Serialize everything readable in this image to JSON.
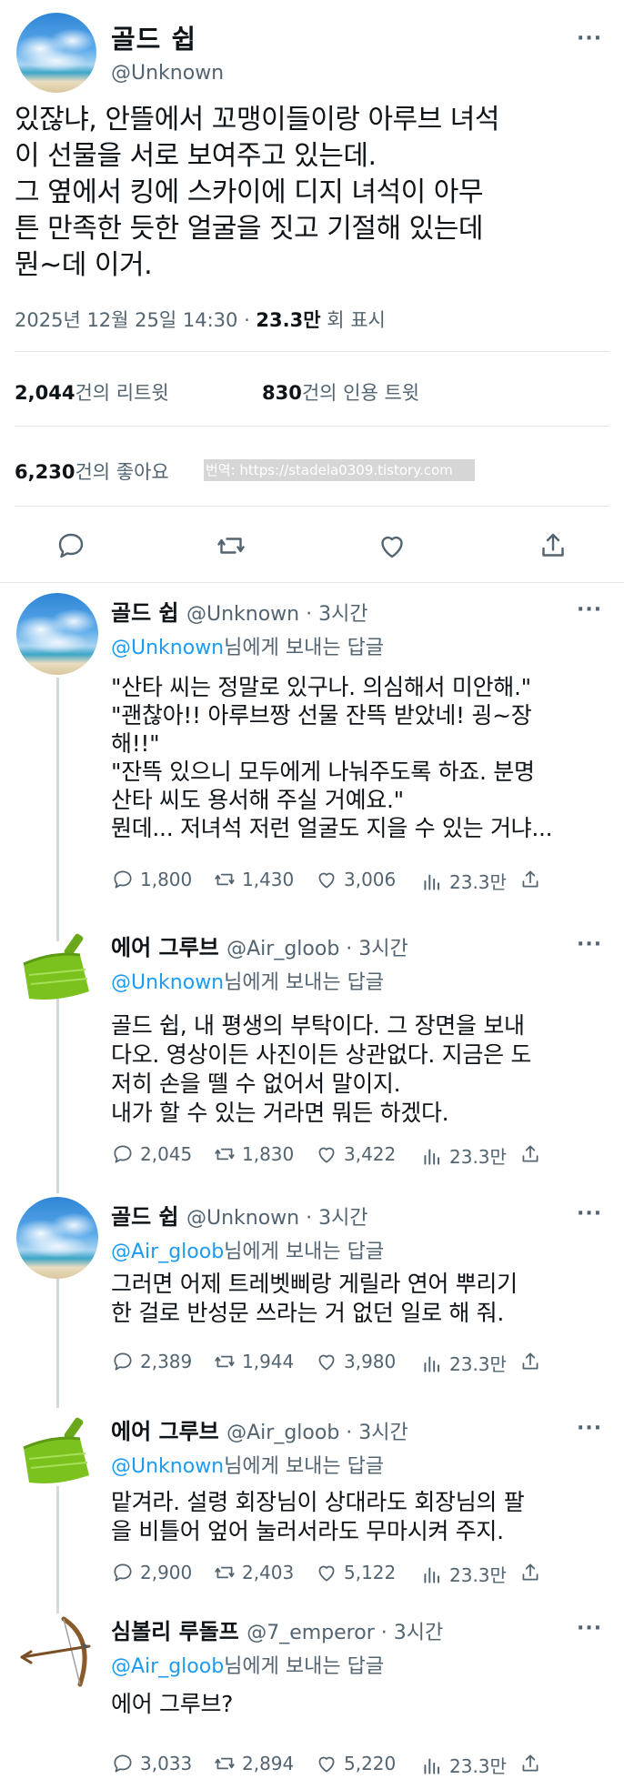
{
  "main": {
    "name": "골드 쉽",
    "handle": "@Unknown",
    "text": "있잖냐, 안뜰에서 꼬맹이들이랑 아루브 녀석\n이 선물을 서로 보여주고 있는데.\n그 옆에서 킹에 스카이에 디지 녀석이 아무\n튼 만족한 듯한 얼굴을 짓고 기절해 있는데\n뭔~데 이거.",
    "date": "2025년 12월 25일  14:30 · ",
    "views": "23.3만",
    "views_suffix": " 회 표시",
    "retweets_count": "2,044",
    "retweets_label": "건의 리트윗",
    "quotes_count": "830",
    "quotes_label": "건의 인용 트윗",
    "likes_count": "6,230",
    "likes_label": "건의 좋아요",
    "watermark": "번역: https://stadela0309.tistory.com",
    "more": "···"
  },
  "replies": [
    {
      "name": "골드 쉽",
      "handle": "@Unknown · 3시간",
      "reply_to_mention": "@Unknown",
      "reply_to_suffix": "님에게 보내는 답글",
      "text": "\"산타 씨는 정말로 있구나. 의심해서 미안해.\"\n\"괜찮아!! 아루브짱 선물 잔뜩 받았네! 굉~장\n해!!\"\n\"잔뜩 있으니 모두에게 나눠주도록 하죠. 분명\n산타 씨도 용서해 주실 거예요.\"\n뭔데... 저녀석 저런 얼굴도 지을 수 있는 거냐...",
      "replies": "1,800",
      "retweets": "1,430",
      "likes": "3,006",
      "views": "23.3만",
      "more": "···"
    },
    {
      "name": "에어 그루브",
      "handle": "@Air_gloob · 3시간",
      "reply_to_mention": "@Unknown",
      "reply_to_suffix": "님에게 보내는 답글",
      "text": "골드 쉽, 내 평생의 부탁이다. 그 장면을 보내\n다오. 영상이든 사진이든 상관없다. 지금은 도\n저히 손을 뗄 수 없어서 말이지.\n내가 할 수 있는 거라면 뭐든 하겠다.",
      "replies": "2,045",
      "retweets": "1,830",
      "likes": "3,422",
      "views": "23.3만",
      "more": "···"
    },
    {
      "name": "골드 쉽",
      "handle": "@Unknown · 3시간",
      "reply_to_mention": "@Air_gloob",
      "reply_to_suffix": "님에게 보내는 답글",
      "text": "그러면 어제 트레벳삐랑 게릴라 연어 뿌리기\n한 걸로 반성문 쓰라는 거 없던 일로 해 줘.",
      "replies": "2,389",
      "retweets": "1,944",
      "likes": "3,980",
      "views": "23.3만",
      "more": "···"
    },
    {
      "name": "에어 그루브",
      "handle": "@Air_gloob · 3시간",
      "reply_to_mention": "@Unknown",
      "reply_to_suffix": "님에게 보내는 답글",
      "text": "맡겨라. 설령 회장님이 상대라도 회장님의 팔\n을 비틀어 엎어 눌러서라도 무마시켜 주지.",
      "replies": "2,900",
      "retweets": "2,403",
      "likes": "5,122",
      "views": "23.3만",
      "more": "···"
    },
    {
      "name": "심볼리 루돌프",
      "handle": "@7_emperor · 3시간",
      "reply_to_mention": "@Air_gloob",
      "reply_to_suffix": "님에게 보내는 답글",
      "text": "에어 그루브?",
      "replies": "3,033",
      "retweets": "2,894",
      "likes": "5,220",
      "views": "23.3만",
      "more": "···"
    }
  ],
  "colors": {
    "link": "#1d9bf0",
    "secondary": "#536471",
    "text": "#0f1419",
    "dustpan": "#7cc21f"
  },
  "icons": [
    "reply-icon",
    "retweet-icon",
    "like-icon",
    "share-icon",
    "views-icon",
    "more-icon",
    "sky-avatar",
    "dustpan-avatar",
    "bow-arrow-avatar"
  ]
}
